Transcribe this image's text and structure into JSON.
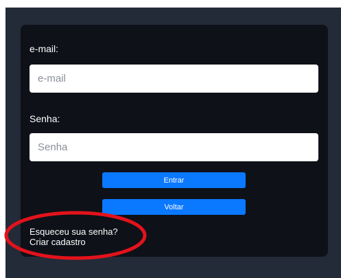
{
  "login": {
    "email_label": "e-mail:",
    "email_placeholder": "e-mail",
    "email_value": "",
    "password_label": "Senha:",
    "password_placeholder": "Senha",
    "password_value": "",
    "submit_label": "Entrar",
    "back_label": "Voltar",
    "forgot_link": "Esqueceu sua senha?",
    "signup_link": "Criar cadastro"
  },
  "colors": {
    "page_background": "#232b38",
    "card_background": "#0e1118",
    "button_primary": "#0a78ff",
    "annotation_red": "#e3121b"
  }
}
